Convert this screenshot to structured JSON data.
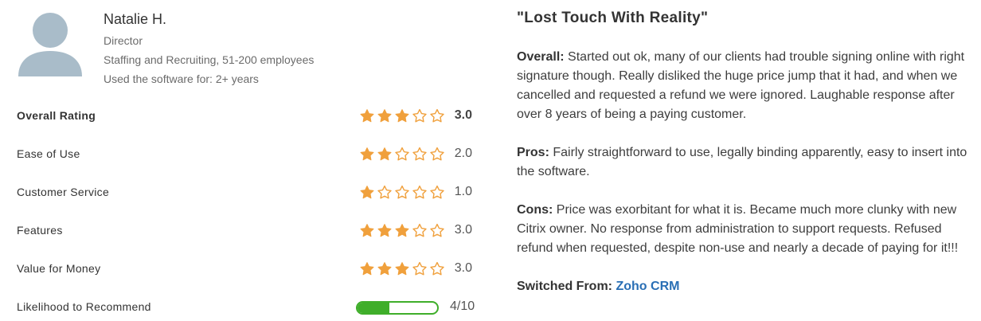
{
  "reviewer": {
    "name": "Natalie H.",
    "title": "Director",
    "company": "Staffing and Recruiting, 51-200 employees",
    "usage": "Used the software for: 2+ years",
    "avatar_icon": "user-avatar-icon"
  },
  "ratings": [
    {
      "label": "Overall Rating",
      "stars": 3,
      "value": "3.0",
      "bold": true
    },
    {
      "label": "Ease of Use",
      "stars": 2,
      "value": "2.0"
    },
    {
      "label": "Customer Service",
      "stars": 1,
      "value": "1.0"
    },
    {
      "label": "Features",
      "stars": 3,
      "value": "3.0"
    },
    {
      "label": "Value for Money",
      "stars": 3,
      "value": "3.0"
    }
  ],
  "recommend": {
    "label": "Likelihood to Recommend",
    "score": 4,
    "max": 10,
    "value": "4/10"
  },
  "review": {
    "title": "\"Lost Touch With Reality\"",
    "overall_label": "Overall:",
    "overall_text": "Started out ok, many of our clients had trouble signing online with right signature though. Really disliked the huge price jump that it had, and when we cancelled and requested a refund we were ignored. Laughable response after over 8 years of being a paying customer.",
    "pros_label": "Pros:",
    "pros_text": "Fairly straightforward to use, legally binding apparently, easy to insert into the software.",
    "cons_label": "Cons:",
    "cons_text": "Price was exorbitant for what it is. Became much more clunky with new Citrix owner. No response from administration to support requests. Refused refund when requested, despite non-use and nearly a decade of paying for it!!!",
    "switched_label": "Switched From:",
    "switched_product": "Zoho CRM"
  },
  "colors": {
    "star": "#f0a03c",
    "progress": "#3fae2a",
    "link": "#2a6fb5",
    "avatar": "#a9bcc9"
  }
}
